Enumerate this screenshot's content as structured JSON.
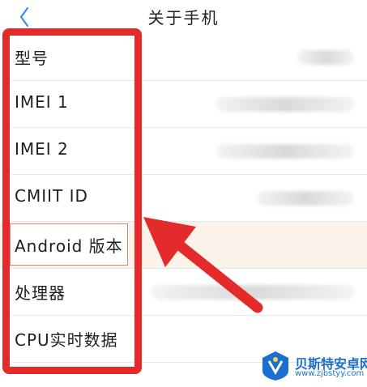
{
  "header": {
    "title": "关于手机"
  },
  "rows": [
    {
      "label": "型号",
      "value_width": 70
    },
    {
      "label": "IMEI 1",
      "value_width": 170
    },
    {
      "label": "IMEI 2",
      "value_width": 170
    },
    {
      "label": "CMIIT ID",
      "value_width": 120
    },
    {
      "label": "Android 版本",
      "value_width": 0
    },
    {
      "label": "处理器",
      "value_width": 250
    },
    {
      "label": "CPU实时数据",
      "value_width": 0
    }
  ],
  "annotation": {
    "frame_color": "#e32b2b",
    "arrow_color": "#e32b2b"
  },
  "watermark": {
    "name": "贝斯特安卓网",
    "url": "www.zjbstyy.com",
    "color": "#1a6fd1"
  }
}
